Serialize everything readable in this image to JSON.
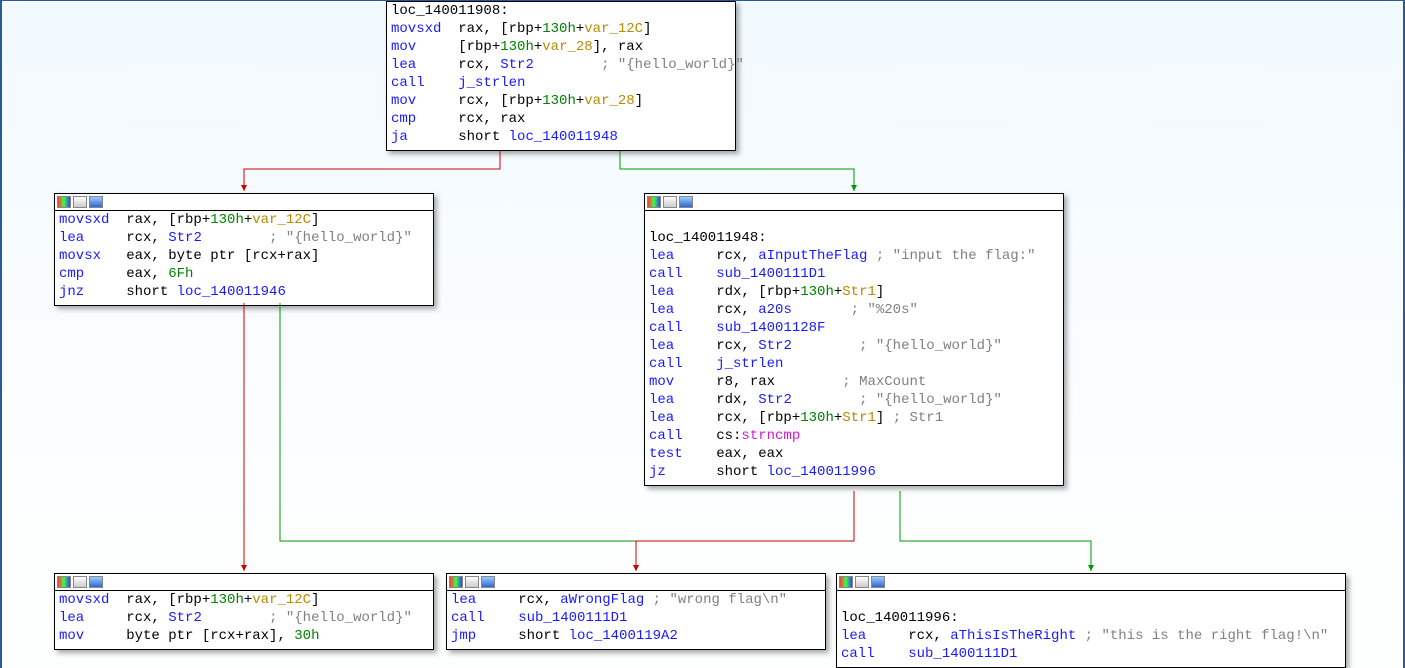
{
  "nodes": {
    "top": {
      "label": "loc_140011908:",
      "l1_mn": "movsxd",
      "l1_ops": "  rax, [rbp",
      "l1_p": "+",
      "l1_n": "130h",
      "l1_p2": "+",
      "l1_v": "var_12C",
      "l1_c": "]",
      "l2_mn": "mov",
      "l2_ops": "     [rbp",
      "l2_p": "+",
      "l2_n": "130h",
      "l2_p2": "+",
      "l2_v": "var_28",
      "l2_c": "], rax",
      "l3_mn": "lea",
      "l3_ops": "     rcx, ",
      "l3_sym": "Str2",
      "l3_pad": "        ",
      "l3_cmt": "; \"{hello_world}\"",
      "l4_mn": "call",
      "l4_ops": "    ",
      "l4_tgt": "j_strlen",
      "l5_mn": "mov",
      "l5_ops": "     rcx, [rbp",
      "l5_p": "+",
      "l5_n": "130h",
      "l5_p2": "+",
      "l5_v": "var_28",
      "l5_c": "]",
      "l6_mn": "cmp",
      "l6_ops": "     rcx, rax",
      "l7_mn": "ja",
      "l7_ops": "      short ",
      "l7_tgt": "loc_140011948"
    },
    "left1": {
      "l1_mn": "movsxd",
      "l1_ops": "  rax, [rbp",
      "l1_p": "+",
      "l1_n": "130h",
      "l1_p2": "+",
      "l1_v": "var_12C",
      "l1_c": "]",
      "l2_mn": "lea",
      "l2_ops": "     rcx, ",
      "l2_sym": "Str2",
      "l2_pad": "        ",
      "l2_cmt": "; \"{hello_world}\"",
      "l3_mn": "movsx",
      "l3_ops": "   eax, byte ptr [rcx+rax]",
      "l4_mn": "cmp",
      "l4_ops": "     eax, ",
      "l4_n": "6Fh",
      "l5_mn": "jnz",
      "l5_ops": "     short ",
      "l5_tgt": "loc_140011946"
    },
    "right1": {
      "label": "loc_140011948:",
      "l1_mn": "lea",
      "l1_ops": "     rcx, ",
      "l1_sym": "aInputTheFlag",
      "l1_pad": " ",
      "l1_cmt": "; \"input the flag:\"",
      "l2_mn": "call",
      "l2_ops": "    ",
      "l2_tgt": "sub_1400111D1",
      "l3_mn": "lea",
      "l3_ops": "     rdx, [rbp",
      "l3_p": "+",
      "l3_n": "130h",
      "l3_p2": "+",
      "l3_v": "Str1",
      "l3_c": "]",
      "l4_mn": "lea",
      "l4_ops": "     rcx, ",
      "l4_sym": "a20s",
      "l4_pad": "       ",
      "l4_cmt": "; \"%20s\"",
      "l5_mn": "call",
      "l5_ops": "    ",
      "l5_tgt": "sub_14001128F",
      "l6_mn": "lea",
      "l6_ops": "     rcx, ",
      "l6_sym": "Str2",
      "l6_pad": "        ",
      "l6_cmt": "; \"{hello_world}\"",
      "l7_mn": "call",
      "l7_ops": "    ",
      "l7_tgt": "j_strlen",
      "l8_mn": "mov",
      "l8_ops": "     r8, rax",
      "l8_pad": "        ",
      "l8_cmt": "; MaxCount",
      "l9_mn": "lea",
      "l9_ops": "     rdx, ",
      "l9_sym": "Str2",
      "l9_pad": "        ",
      "l9_cmt": "; \"{hello_world}\"",
      "l10_mn": "lea",
      "l10_ops": "     rcx, [rbp",
      "l10_p": "+",
      "l10_n": "130h",
      "l10_p2": "+",
      "l10_v": "Str1",
      "l10_c": "] ",
      "l10_cmt": "; Str1",
      "l11_mn": "call",
      "l11_ops": "    cs:",
      "l11_ext": "strncmp",
      "l12_mn": "test",
      "l12_ops": "    eax, eax",
      "l13_mn": "jz",
      "l13_ops": "      short ",
      "l13_tgt": "loc_140011996"
    },
    "left2": {
      "l1_mn": "movsxd",
      "l1_ops": "  rax, [rbp",
      "l1_p": "+",
      "l1_n": "130h",
      "l1_p2": "+",
      "l1_v": "var_12C",
      "l1_c": "]",
      "l2_mn": "lea",
      "l2_ops": "     rcx, ",
      "l2_sym": "Str2",
      "l2_pad": "        ",
      "l2_cmt": "; \"{hello_world}\"",
      "l3_mn": "mov",
      "l3_ops": "     byte ptr [rcx+rax], ",
      "l3_n": "30h"
    },
    "mid2": {
      "l1_mn": "lea",
      "l1_ops": "     rcx, ",
      "l1_sym": "aWrongFlag",
      "l1_pad": " ",
      "l1_cmt": "; \"wrong flag\\n\"",
      "l2_mn": "call",
      "l2_ops": "    ",
      "l2_tgt": "sub_1400111D1",
      "l3_mn": "jmp",
      "l3_ops": "     short ",
      "l3_tgt": "loc_1400119A2"
    },
    "right2": {
      "label": "loc_140011996:",
      "l1_mn": "lea",
      "l1_ops": "     rcx, ",
      "l1_sym": "aThisIsTheRight",
      "l1_pad": " ",
      "l1_cmt": "; \"this is the right flag!\\n\"",
      "l2_mn": "call",
      "l2_ops": "    ",
      "l2_tgt": "sub_1400111D1"
    }
  },
  "colors": {
    "edge_true": "#009900",
    "edge_false": "#cc0000",
    "edge_plain": "#1a1aff"
  }
}
